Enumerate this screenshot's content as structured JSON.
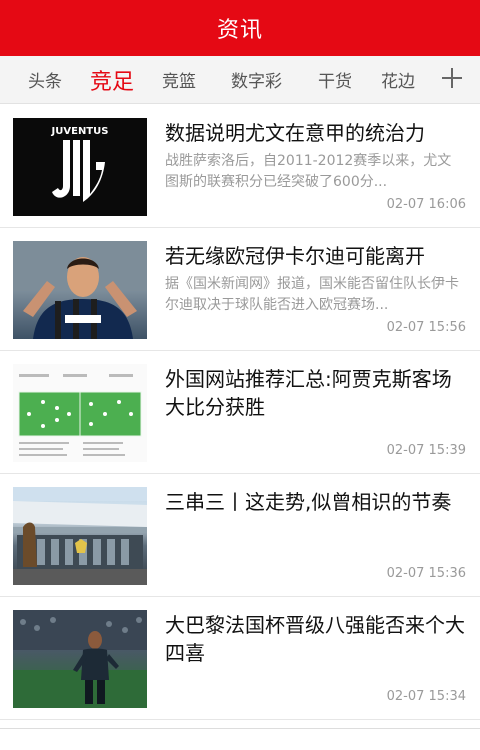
{
  "header": {
    "title": "资讯"
  },
  "tabs": [
    {
      "label": "头条",
      "active": false
    },
    {
      "label": "竞足",
      "active": true
    },
    {
      "label": "竞篮",
      "active": false
    },
    {
      "label": "数字彩",
      "active": false
    },
    {
      "label": "干货",
      "active": false
    },
    {
      "label": "花边",
      "active": false
    }
  ],
  "tabs_more_icon": "plus-icon",
  "colors": {
    "brand": "#e50914",
    "active_tab": "#e50914",
    "muted_text": "#9a9a9a"
  },
  "articles": [
    {
      "title": "数据说明尤文在意甲的统治力",
      "summary": "战胜萨索洛后，自2011-2012赛季以来，尤文图斯的联赛积分已经突破了600分...",
      "time": "02-07 16:06",
      "thumb_logo_text": "JUVENTUS"
    },
    {
      "title": "若无缘欧冠伊卡尔迪可能离开",
      "summary": "据《国米新闻网》报道，国米能否留住队长伊卡尔迪取决于球队能否进入欧冠赛场...",
      "time": "02-07 15:56"
    },
    {
      "title": "外国网站推荐汇总:阿贾克斯客场大比分获胜",
      "summary": "",
      "time": "02-07 15:39"
    },
    {
      "title": "三串三丨这走势,似曾相识的节奏",
      "summary": "",
      "time": "02-07 15:36"
    },
    {
      "title": "大巴黎法国杯晋级八强能否来个大四喜",
      "summary": "",
      "time": "02-07 15:34"
    }
  ]
}
